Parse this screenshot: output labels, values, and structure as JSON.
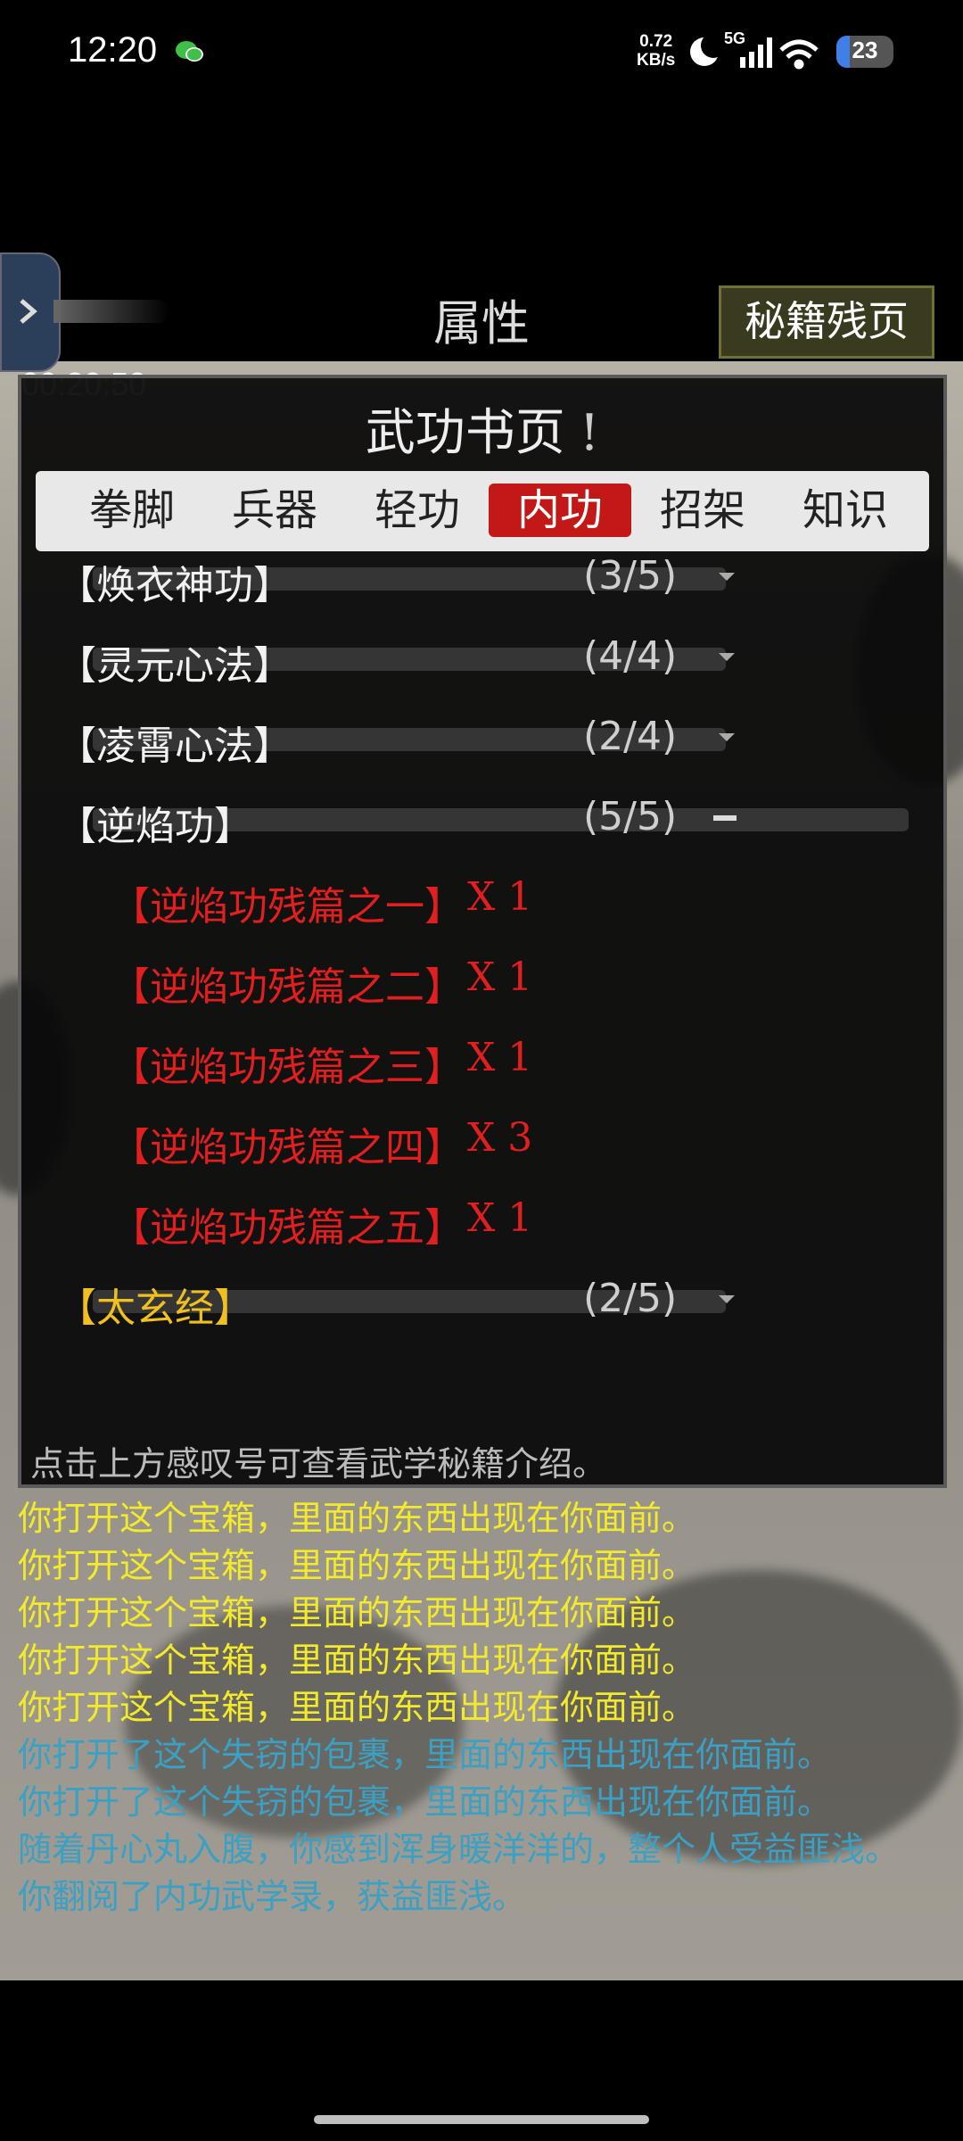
{
  "status": {
    "time": "12:20",
    "net_speed_value": "0.72",
    "net_speed_unit": "KB/s",
    "network": "5G",
    "battery": "23",
    "battery_percent": 23
  },
  "header": {
    "title": "属性",
    "secret_button": "秘籍残页",
    "timer": "00:20:50"
  },
  "dialog": {
    "title": "武功书页",
    "info_mark": "!",
    "tabs": [
      {
        "label": "拳脚",
        "active": false
      },
      {
        "label": "兵器",
        "active": false
      },
      {
        "label": "轻功",
        "active": false
      },
      {
        "label": "内功",
        "active": true
      },
      {
        "label": "招架",
        "active": false
      },
      {
        "label": "知识",
        "active": false
      }
    ],
    "skills": [
      {
        "name": "【焕衣神功】",
        "count": "(3/5)"
      },
      {
        "name": "【灵元心法】",
        "count": "(4/4)"
      },
      {
        "name": "【凌霄心法】",
        "count": "(2/4)"
      },
      {
        "name": "【逆焰功】",
        "count": "(5/5)"
      },
      {
        "name": "【太玄经】",
        "count": "(2/5)"
      }
    ],
    "fragments": [
      {
        "name": "【逆焰功残篇之一】",
        "qty": "X 1"
      },
      {
        "name": "【逆焰功残篇之二】",
        "qty": "X 1"
      },
      {
        "name": "【逆焰功残篇之三】",
        "qty": "X 1"
      },
      {
        "name": "【逆焰功残篇之四】",
        "qty": "X 3"
      },
      {
        "name": "【逆焰功残篇之五】",
        "qty": "X 1"
      }
    ],
    "hint": "点击上方感叹号可查看武学秘籍介绍。"
  },
  "log": {
    "lines": [
      {
        "text": "你打开这个宝箱，里面的东西出现在你面前。",
        "color": "yellow"
      },
      {
        "text": "你打开这个宝箱，里面的东西出现在你面前。",
        "color": "yellow"
      },
      {
        "text": "你打开这个宝箱，里面的东西出现在你面前。",
        "color": "yellow"
      },
      {
        "text": "你打开这个宝箱，里面的东西出现在你面前。",
        "color": "yellow"
      },
      {
        "text": "你打开这个宝箱，里面的东西出现在你面前。",
        "color": "yellow"
      },
      {
        "text": "你打开了这个失窃的包裹，里面的东西出现在你面前。",
        "color": "cyan"
      },
      {
        "text": "你打开了这个失窃的包裹，里面的东西出现在你面前。",
        "color": "cyan"
      },
      {
        "text": "随着丹心丸入腹，你感到浑身暖洋洋的，整个人受益匪浅。",
        "color": "cyan"
      },
      {
        "text": "你翻阅了内功武学录，获益匪浅。",
        "color": "cyan"
      }
    ]
  }
}
